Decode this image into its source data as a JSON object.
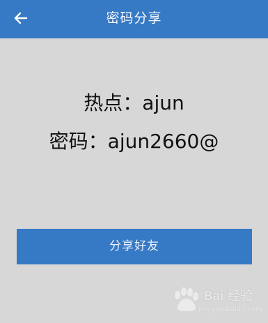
{
  "header": {
    "title": "密码分享",
    "back_icon": "arrow-left-icon"
  },
  "hotspot": {
    "label": "热点：",
    "value": "ajun"
  },
  "password": {
    "label": "密码：",
    "value": "ajun2660@"
  },
  "actions": {
    "share_label": "分享好友"
  },
  "watermark": {
    "brand": "Bai 经验",
    "url": "jingyan.baidu.com",
    "icon": "baidu-paw-icon"
  },
  "colors": {
    "accent": "#3679c4",
    "background": "#d7d7d7",
    "text": "#111111"
  }
}
